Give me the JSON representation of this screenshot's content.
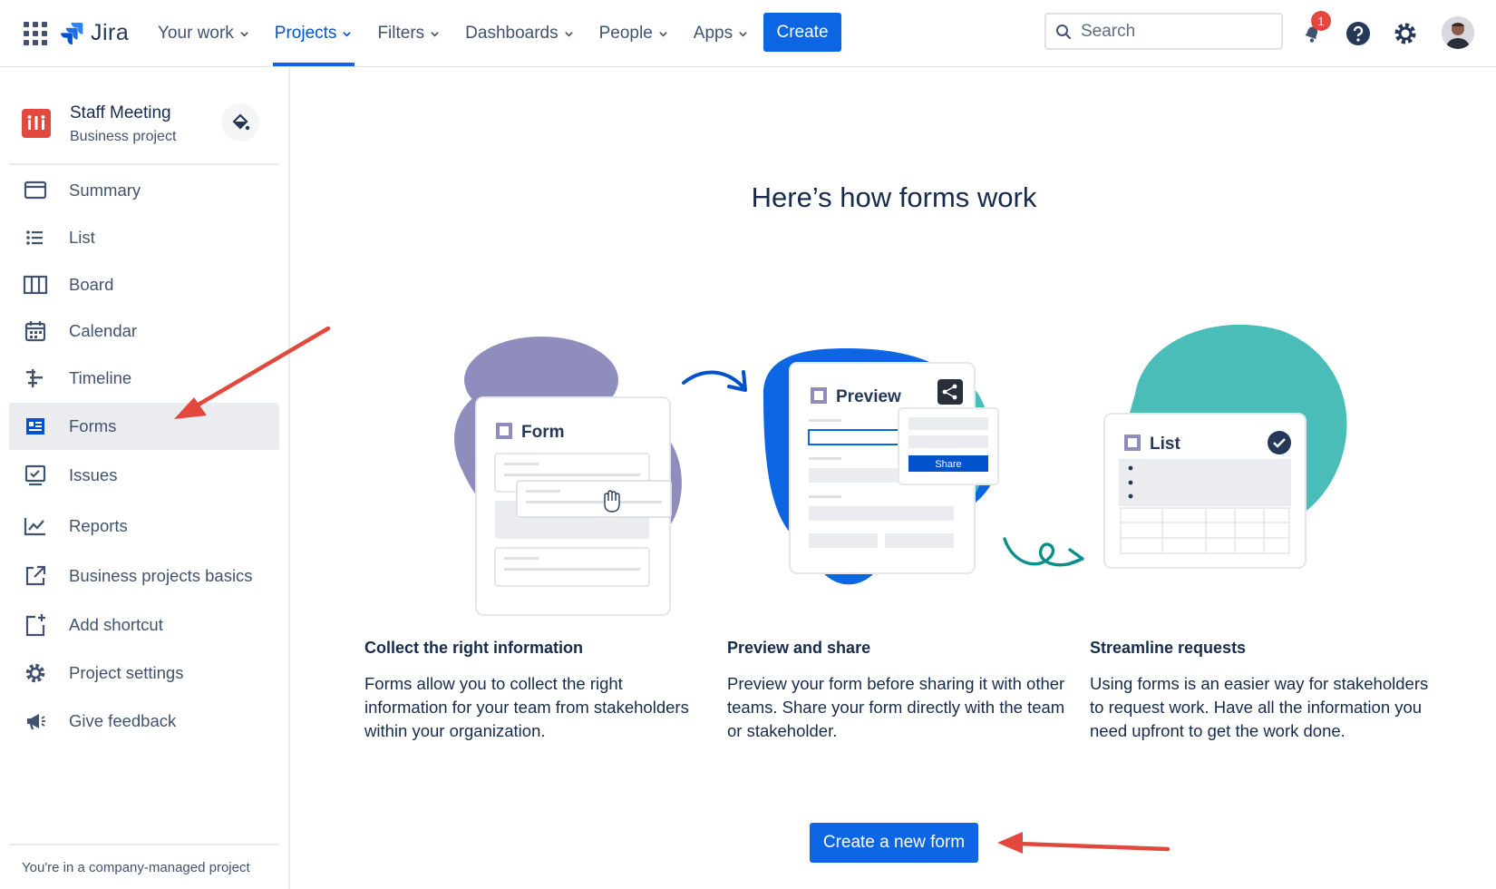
{
  "topnav": {
    "logo_text": "Jira",
    "items": [
      {
        "label": "Your work"
      },
      {
        "label": "Projects"
      },
      {
        "label": "Filters"
      },
      {
        "label": "Dashboards"
      },
      {
        "label": "People"
      },
      {
        "label": "Apps"
      }
    ],
    "active_item": "Projects",
    "create_label": "Create",
    "search_placeholder": "Search",
    "notification_count": "1",
    "accent_color": "#0c66e4"
  },
  "sidebar": {
    "project_name": "Staff Meeting",
    "project_type": "Business project",
    "items": [
      {
        "label": "Summary",
        "icon": "summary-icon"
      },
      {
        "label": "List",
        "icon": "list-icon"
      },
      {
        "label": "Board",
        "icon": "board-icon"
      },
      {
        "label": "Calendar",
        "icon": "calendar-icon"
      },
      {
        "label": "Timeline",
        "icon": "timeline-icon"
      },
      {
        "label": "Forms",
        "icon": "forms-icon"
      },
      {
        "label": "Issues",
        "icon": "issues-icon"
      },
      {
        "label": "Reports",
        "icon": "reports-icon"
      },
      {
        "label": "Business projects basics",
        "icon": "external-link-icon"
      },
      {
        "label": "Add shortcut",
        "icon": "add-shortcut-icon"
      },
      {
        "label": "Project settings",
        "icon": "gear-icon"
      },
      {
        "label": "Give feedback",
        "icon": "megaphone-icon"
      }
    ],
    "selected_item": "Forms",
    "footer_text": "You're in a company-managed project"
  },
  "main": {
    "title": "Here’s how forms work",
    "illustration": {
      "form_card_title": "Form",
      "preview_card_title": "Preview",
      "share_button": "Share",
      "list_card_title": "List"
    },
    "features": [
      {
        "heading": "Collect the right information",
        "body": "Forms allow you to collect the right information for your team from stakeholders within your organization."
      },
      {
        "heading": "Preview and share",
        "body": "Preview your form before sharing it with other teams. Share your form directly with the team or stakeholder."
      },
      {
        "heading": "Streamline requests",
        "body": "Using forms is an easier way for stakeholders to request work. Have all the information you need upfront to get the work done."
      }
    ],
    "cta_label": "Create a new form"
  },
  "colors": {
    "brand_blue": "#0c66e4",
    "purple_blob": "#8f8dbd",
    "teal_blob": "#4bbdb8",
    "annotation_arrow": "#e2483d"
  }
}
